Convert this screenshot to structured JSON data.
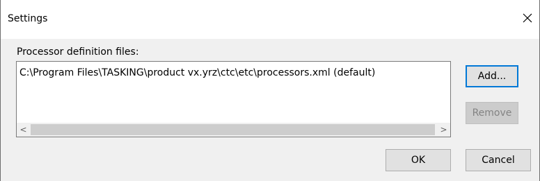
{
  "window": {
    "title": "Settings"
  },
  "processor_files": {
    "label": "Processor definition files:",
    "items": [
      "C:\\Program Files\\TASKING\\product vx.yrz\\ctc\\etc\\processors.xml (default)"
    ]
  },
  "scrollbar": {
    "left_arrow": "<",
    "right_arrow": ">"
  },
  "buttons": {
    "add": "Add...",
    "remove": "Remove",
    "ok": "OK",
    "cancel": "Cancel"
  },
  "icons": {
    "close": "close-icon"
  },
  "colors": {
    "accent": "#0078d7",
    "dialog_background": "#f0f0f0",
    "button_background": "#e1e1e1",
    "disabled_text": "#838383"
  }
}
